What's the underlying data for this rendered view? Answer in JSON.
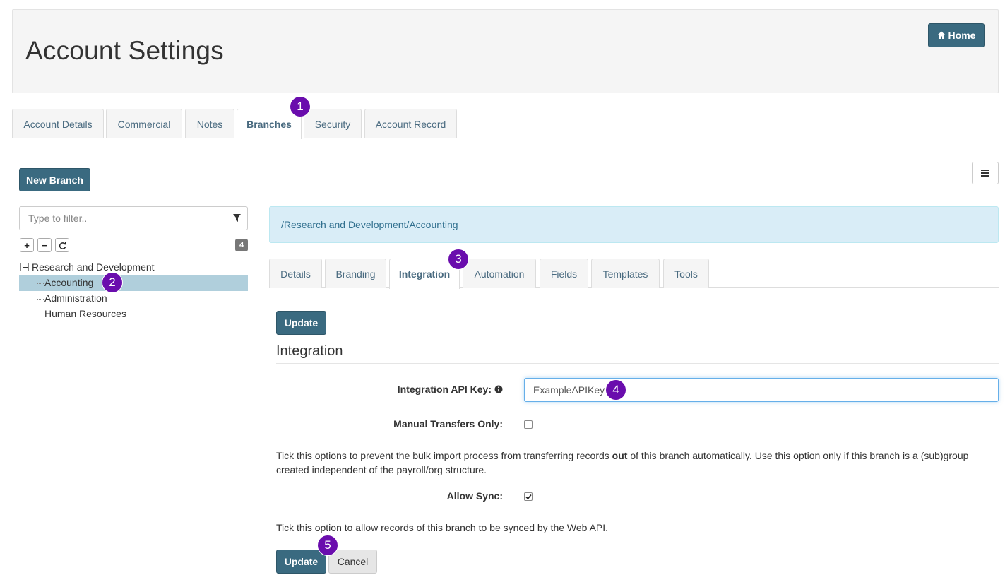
{
  "header": {
    "title": "Account Settings",
    "home_label": "Home"
  },
  "main_tabs": [
    {
      "label": "Account Details"
    },
    {
      "label": "Commercial"
    },
    {
      "label": "Notes"
    },
    {
      "label": "Branches",
      "active": true
    },
    {
      "label": "Security"
    },
    {
      "label": "Account Record"
    }
  ],
  "annotations": [
    "1",
    "2",
    "3",
    "4",
    "5"
  ],
  "sidebar": {
    "new_branch_label": "New Branch",
    "filter_placeholder": "Type to filter..",
    "count": "4",
    "tree": {
      "root": "Research and Development",
      "children": [
        "Accounting",
        "Administration",
        "Human Resources"
      ],
      "selected": "Accounting"
    }
  },
  "branch_path": "/Research and Development/Accounting",
  "sub_tabs": [
    {
      "label": "Details"
    },
    {
      "label": "Branding"
    },
    {
      "label": "Integration",
      "active": true
    },
    {
      "label": "Automation"
    },
    {
      "label": "Fields"
    },
    {
      "label": "Templates"
    },
    {
      "label": "Tools"
    }
  ],
  "form": {
    "update_label": "Update",
    "section_title": "Integration",
    "api_key_label": "Integration API Key:",
    "api_key_value": "ExampleAPIKey",
    "manual_transfers_label": "Manual Transfers Only:",
    "manual_transfers_checked": false,
    "manual_help_prefix": "Tick this options to prevent the bulk import process from transferring records ",
    "manual_help_bold": "out",
    "manual_help_suffix": " of this branch automatically. Use this option only if this branch is a (sub)group created independent of the payroll/org structure.",
    "allow_sync_label": "Allow Sync:",
    "allow_sync_checked": true,
    "allow_sync_help": "Tick this option to allow records of this branch to be synced by the Web API.",
    "cancel_label": "Cancel"
  },
  "colors": {
    "primary": "#3a6a80",
    "badge": "#6a0dad",
    "alert_bg": "#d9edf7",
    "selected_row": "#b0cfdc"
  }
}
